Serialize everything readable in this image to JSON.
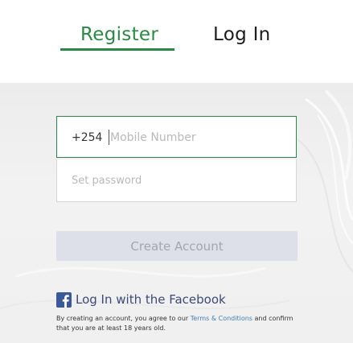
{
  "tabs": {
    "register_label": "Register",
    "login_label": "Log In"
  },
  "form": {
    "country_code": "+254",
    "mobile_placeholder": "Mobile Number",
    "password_placeholder": "Set password",
    "create_button_label": "Create Account"
  },
  "facebook": {
    "icon": "facebook-icon",
    "label": "Log In with the Facebook"
  },
  "legal": {
    "text_before": "By creating an account, you agree to our ",
    "link_label": "Terms & Conditions",
    "text_after": " and confirm that you are at least 18 years old."
  },
  "colors": {
    "accent": "#2a8a44",
    "facebook": "#3b5998",
    "link": "#3d7fb5",
    "button_disabled_bg": "#dde0e8"
  }
}
